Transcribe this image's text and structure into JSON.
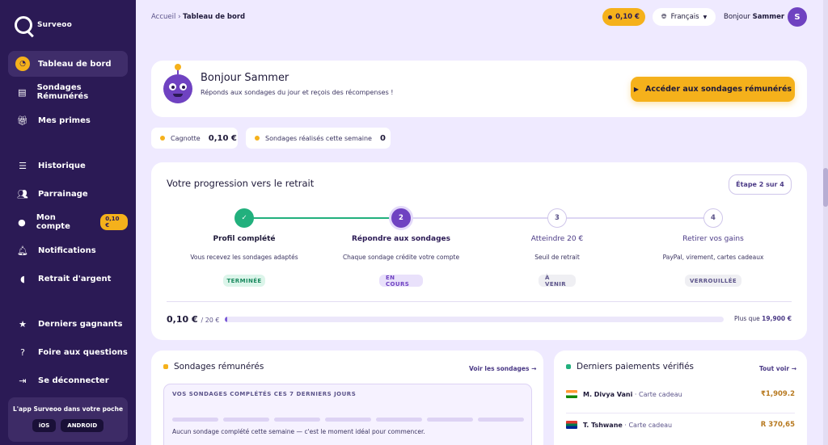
{
  "brand": {
    "name": "Surveoo"
  },
  "sidebar": {
    "items": [
      {
        "label": "Tableau de bord",
        "icon": "dashboard-icon"
      },
      {
        "label": "Sondages Rémunérés",
        "icon": "document-icon"
      },
      {
        "label": "Mes primes",
        "icon": "gift-icon"
      },
      {
        "label": "Historique",
        "icon": "list-icon"
      },
      {
        "label": "Parrainage",
        "icon": "users-icon"
      },
      {
        "label": "Mon compte",
        "icon": "account-icon",
        "badge": "0,10 €"
      },
      {
        "label": "Notifications",
        "icon": "bell-icon"
      },
      {
        "label": "Retrait d'argent",
        "icon": "piggy-bank-icon"
      },
      {
        "label": "Derniers gagnants",
        "icon": "star-icon"
      },
      {
        "label": "Foire aux questions",
        "icon": "help-icon"
      },
      {
        "label": "Se déconnecter",
        "icon": "logout-icon"
      }
    ],
    "app": {
      "title": "L'app Surveoo dans votre poche",
      "ios": "iOS",
      "android": "ANDROID"
    }
  },
  "topbar": {
    "breadcrumb_root": "Accueil",
    "breadcrumb_sep": "›",
    "breadcrumb_current": "Tableau de bord",
    "balance": "0,10 €",
    "language": "Français",
    "greeting_prefix": "Bonjour",
    "greeting_name": "Sammer",
    "avatar_initial": "S"
  },
  "welcome": {
    "title": "Bonjour Sammer",
    "subtitle": "Réponds aux sondages du jour et reçois des récompenses !",
    "cta": "Accéder aux sondages rémunérés"
  },
  "stats": [
    {
      "label": "Cagnotte",
      "value": "0,10 €"
    },
    {
      "label": "Sondages réalisés cette semaine",
      "value": "0"
    }
  ],
  "progress": {
    "title": "Votre progression vers le retrait",
    "step_indicator": "Étape 2 sur 4",
    "steps": [
      {
        "number": "✓",
        "title": "Profil complété",
        "desc": "Vous recevez les sondages adaptés",
        "badge": "TERMINÉE"
      },
      {
        "number": "2",
        "title": "Répondre aux sondages",
        "desc": "Chaque sondage crédite votre compte",
        "badge": "EN COURS"
      },
      {
        "number": "3",
        "title": "Atteindre 20 €",
        "desc": "Seuil de retrait",
        "badge": "À VENIR"
      },
      {
        "number": "4",
        "title": "Retirer vos gains",
        "desc": "PayPal, virement, cartes cadeaux",
        "badge": "VERROUILLÉE"
      }
    ],
    "amount": "0,10 €",
    "target": "/ 20 €",
    "fill_fraction": 0.005,
    "more_prefix": "Plus que",
    "more_value": "19,900 €"
  },
  "surveys": {
    "title": "Sondages rémunérés",
    "link": "Voir les sondages →",
    "inner_heading": "VOS SONDAGES COMPLÉTÉS CES 7 DERNIERS JOURS",
    "empty_message": "Aucun sondage complété cette semaine — c'est le moment idéal pour commencer."
  },
  "payments": {
    "title": "Derniers paiements vérifiés",
    "link": "Tout voir →",
    "rows": [
      {
        "name": "M. Divya Vani",
        "method": "· Carte cadeau",
        "amount": "₹1,909.2",
        "flag": "india-flag-icon"
      },
      {
        "name": "T. Tshwane",
        "method": "· Carte cadeau",
        "amount": "R 370,65",
        "flag": "south-africa-flag-icon"
      }
    ]
  },
  "colors": {
    "accent": "#f5b11b",
    "sidebar": "#2b1a55",
    "primary": "#6f42c1",
    "success": "#22b07d"
  }
}
